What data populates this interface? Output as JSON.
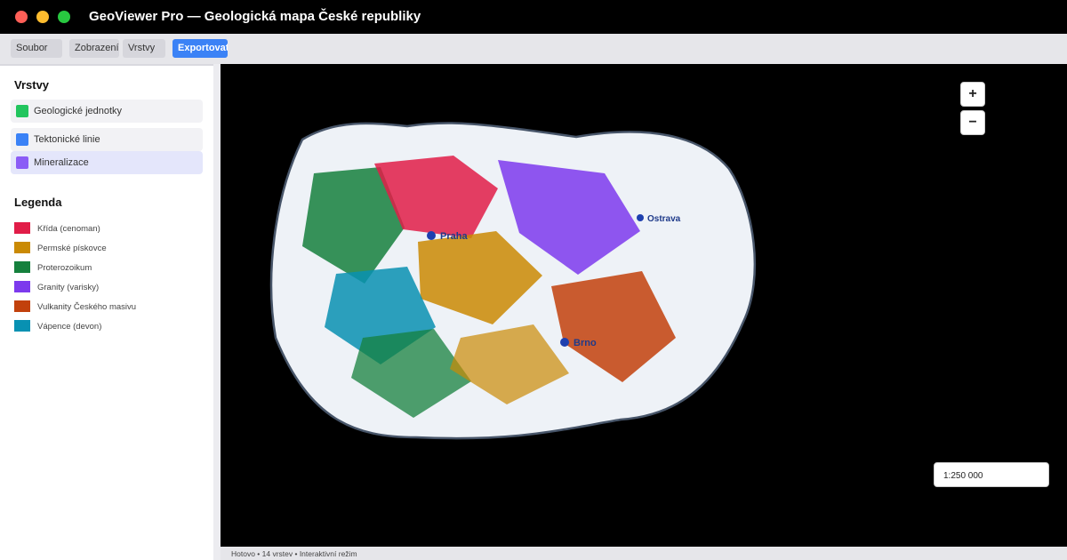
{
  "window": {
    "title": "GeoViewer Pro — Geologická mapa České republiky"
  },
  "menu": {
    "soubor": "Soubor",
    "zobrazeni": "Zobrazení",
    "vrstvy": "Vrstvy",
    "exportovat": "Exportovat"
  },
  "sidebar": {
    "layers_title": "Vrstvy",
    "layers": [
      {
        "label": "Geologické jednotky",
        "color": "#22c55e"
      },
      {
        "label": "Tektonické linie",
        "color": "#3b82f6"
      },
      {
        "label": "Mineralizace",
        "color": "#8b5cf6"
      }
    ],
    "legend_title": "Legenda",
    "legend": [
      {
        "label": "Křída (cenoman)",
        "color": "#e11d48"
      },
      {
        "label": "Permské pískovce",
        "color": "#ca8a04"
      },
      {
        "label": "Proterozoikum",
        "color": "#15803d"
      },
      {
        "label": "Granity (varisky)",
        "color": "#7c3aed"
      },
      {
        "label": "Vulkanity Českého masivu",
        "color": "#c2410c"
      },
      {
        "label": "Vápence (devon)",
        "color": "#0891b2"
      }
    ]
  },
  "map": {
    "cities": {
      "praha": "Praha",
      "ostrava": "Ostrava",
      "brno": "Brno"
    },
    "zoom_in": "+",
    "zoom_out": "−",
    "scale": "1:250 000"
  },
  "status": {
    "text": "Hotovo • 14 vrstev • Interaktivní režim"
  }
}
